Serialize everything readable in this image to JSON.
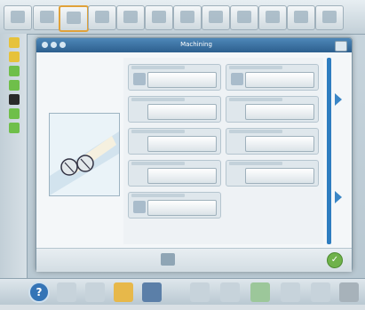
{
  "window": {
    "title": ""
  },
  "dialog": {
    "title": "Machining"
  },
  "settings": {
    "left": [
      {
        "name": "setting-1",
        "value": ""
      },
      {
        "name": "setting-2",
        "value": ""
      },
      {
        "name": "setting-3",
        "value": ""
      },
      {
        "name": "setting-4",
        "value": ""
      },
      {
        "name": "setting-5",
        "value": ""
      }
    ],
    "right": [
      {
        "name": "setting-6",
        "value": ""
      },
      {
        "name": "setting-7",
        "value": ""
      },
      {
        "name": "setting-8",
        "value": ""
      },
      {
        "name": "setting-9",
        "value": ""
      }
    ]
  },
  "colors": {
    "accent": "#2e7dc0",
    "title_bar": "#3b73a6",
    "ok": "#6fb24a"
  },
  "icons": {
    "top_tools": [
      "tool-icon",
      "tool-icon",
      "tool-icon",
      "tool-icon",
      "tool-icon",
      "tool-icon",
      "tool-icon",
      "tool-icon",
      "tool-icon",
      "tool-icon",
      "tool-icon",
      "tool-icon"
    ],
    "bottom_tools": [
      "help-icon",
      "tool-icon",
      "tool-icon",
      "folder-icon",
      "save-icon",
      "tool-icon",
      "tool-icon",
      "tool-icon",
      "tool-icon",
      "tool-icon",
      "tool-icon"
    ]
  },
  "ok": {
    "label": "✓"
  },
  "help": {
    "label": "?"
  }
}
